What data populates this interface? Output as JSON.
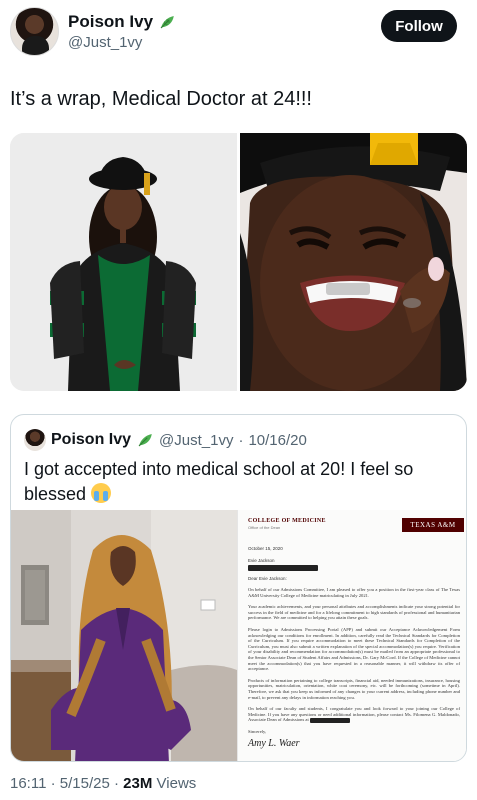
{
  "author": {
    "name": "Poison Ivy",
    "handle": "@Just_1vy",
    "badge_icon": "leaf-icon"
  },
  "follow_label": "Follow",
  "tweet": {
    "text": "It’s a wrap, Medical Doctor at 24!!!"
  },
  "quoted": {
    "name": "Poison Ivy",
    "handle": "@Just_1vy",
    "date": "10/16/20",
    "text": "I got accepted into medical school at 20! I feel so blessed",
    "emoji": "loudly-crying-face-icon"
  },
  "letter": {
    "college": "COLLEGE OF MEDICINE",
    "office": "Office of the Dean",
    "logo": "TEXAS A&M",
    "date": "October 15, 2020",
    "salutation_name": "Evie Jackson",
    "greeting": "Dear Evie Jackson:",
    "paragraphs": [
      "On behalf of our Admissions Committee, I am pleased to offer you a position in the first-year class of The Texas A&M University College of Medicine matriculating in July 2021.",
      "Your academic achievements, and your personal attributes and accomplishments indicate your strong potential for success in the field of medicine and for a lifelong commitment to high standards of professional and humanitarian performance. We are committed to helping you attain these goals.",
      "Please login to Admissions Processing Portal (APP) and submit our Acceptance Acknowledgement Form acknowledging our conditions for enrollment. In addition, carefully read the Technical Standards for Completion of the Curriculum. If you require accommodation to meet these Technical Standards for Completion of the Curriculum, you must also submit a written explanation of the special accommodation(s) you require. Verification of your disability and recommendation for accommodation(s) must be mailed from an appropriate professional to the Senior Associate Dean of Student Affairs and Admissions, Dr. Gary McCord. If the College of Medicine cannot meet the accommodation(s) that you have requested in a reasonable manner, it will withdraw its offer of acceptance.",
      "Products of information pertaining to college transcripts, financial aid, needed immunizations, insurance, housing opportunities, matriculation, orientation, white coat ceremony, etc. will be forthcoming (sometime in April). Therefore, we ask that you keep us informed of any changes to your current address, including phone number and e-mail, to prevent any delays in information reaching you.",
      "On behalf of our faculty and students, I congratulate you and look forward to your joining our College of Medicine. If you have any questions or need additional information, please contact Ms. Filomena G. Maldonado, Associate Dean of Admissions at",
      "Sincerely,"
    ],
    "signature": "Amy L. Waer"
  },
  "footer": {
    "time": "16:11",
    "date": "5/15/25",
    "views": "23M",
    "views_label": "Views"
  }
}
